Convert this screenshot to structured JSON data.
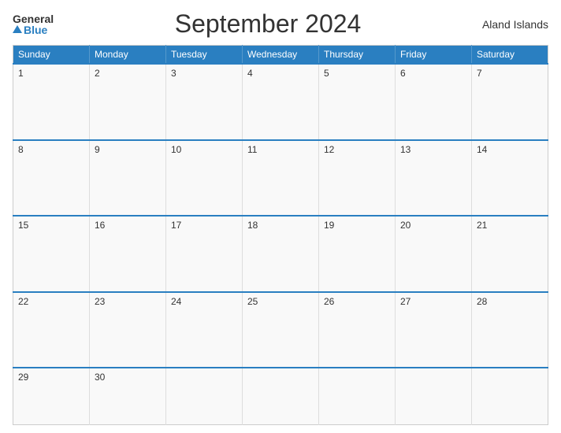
{
  "header": {
    "logo_general": "General",
    "logo_blue": "Blue",
    "title": "September 2024",
    "region": "Aland Islands"
  },
  "days_of_week": [
    "Sunday",
    "Monday",
    "Tuesday",
    "Wednesday",
    "Thursday",
    "Friday",
    "Saturday"
  ],
  "weeks": [
    [
      {
        "day": "1",
        "empty": false
      },
      {
        "day": "2",
        "empty": false
      },
      {
        "day": "3",
        "empty": false
      },
      {
        "day": "4",
        "empty": false
      },
      {
        "day": "5",
        "empty": false
      },
      {
        "day": "6",
        "empty": false
      },
      {
        "day": "7",
        "empty": false
      }
    ],
    [
      {
        "day": "8",
        "empty": false
      },
      {
        "day": "9",
        "empty": false
      },
      {
        "day": "10",
        "empty": false
      },
      {
        "day": "11",
        "empty": false
      },
      {
        "day": "12",
        "empty": false
      },
      {
        "day": "13",
        "empty": false
      },
      {
        "day": "14",
        "empty": false
      }
    ],
    [
      {
        "day": "15",
        "empty": false
      },
      {
        "day": "16",
        "empty": false
      },
      {
        "day": "17",
        "empty": false
      },
      {
        "day": "18",
        "empty": false
      },
      {
        "day": "19",
        "empty": false
      },
      {
        "day": "20",
        "empty": false
      },
      {
        "day": "21",
        "empty": false
      }
    ],
    [
      {
        "day": "22",
        "empty": false
      },
      {
        "day": "23",
        "empty": false
      },
      {
        "day": "24",
        "empty": false
      },
      {
        "day": "25",
        "empty": false
      },
      {
        "day": "26",
        "empty": false
      },
      {
        "day": "27",
        "empty": false
      },
      {
        "day": "28",
        "empty": false
      }
    ],
    [
      {
        "day": "29",
        "empty": false
      },
      {
        "day": "30",
        "empty": false
      },
      {
        "day": "",
        "empty": true
      },
      {
        "day": "",
        "empty": true
      },
      {
        "day": "",
        "empty": true
      },
      {
        "day": "",
        "empty": true
      },
      {
        "day": "",
        "empty": true
      }
    ]
  ]
}
